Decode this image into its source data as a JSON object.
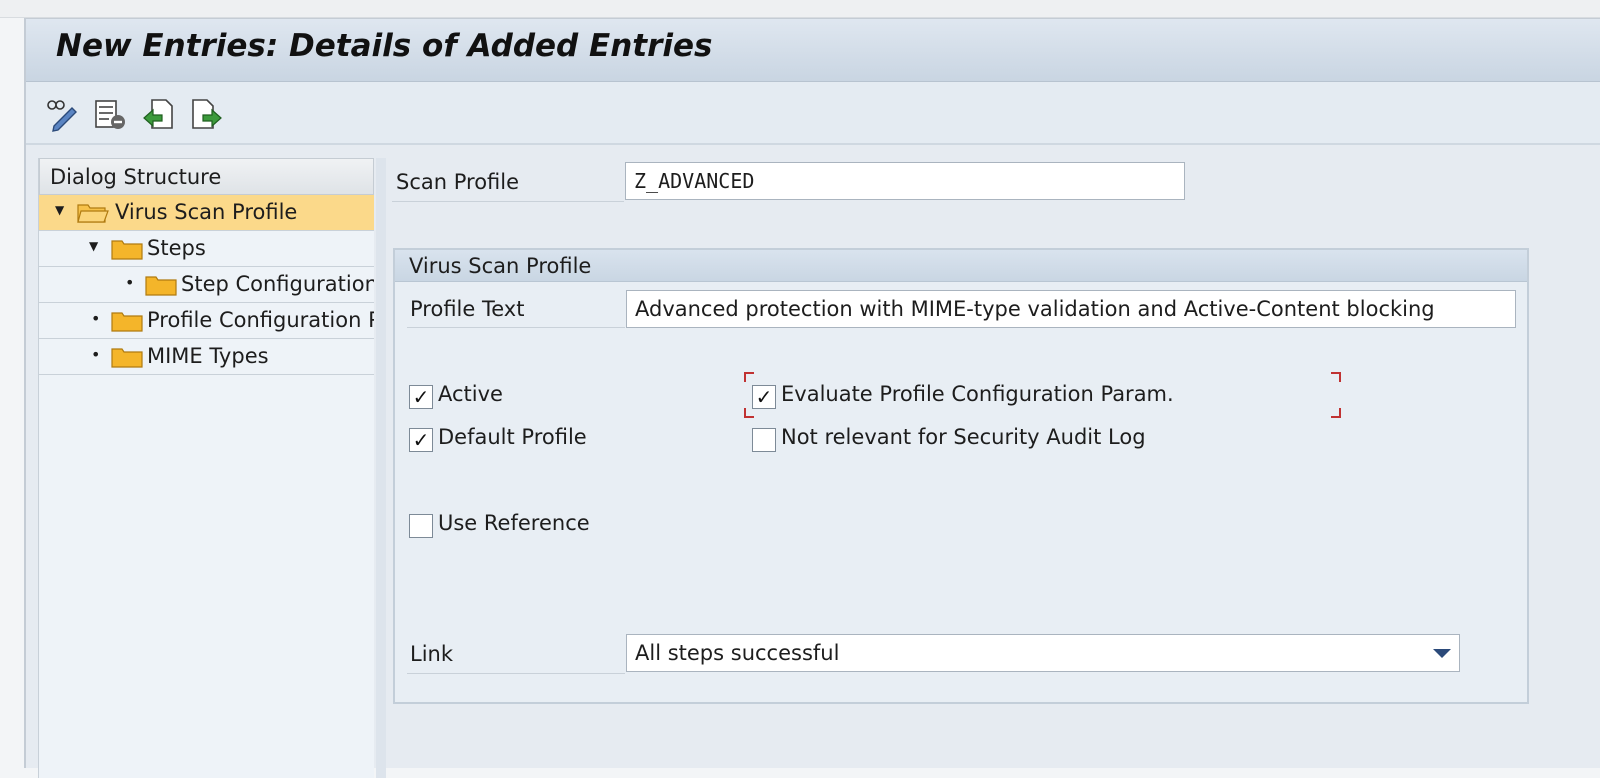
{
  "window": {
    "title": "New Entries: Details of Added Entries"
  },
  "toolbar": {
    "buttons": [
      {
        "icon": "display-change-icon"
      },
      {
        "icon": "delete-row-icon"
      },
      {
        "icon": "previous-entry-icon"
      },
      {
        "icon": "next-entry-icon"
      }
    ]
  },
  "dialog_structure": {
    "header": "Dialog Structure",
    "items": [
      {
        "label": "Virus Scan Profile",
        "level": 0,
        "expander": "▼",
        "selected": true
      },
      {
        "label": "Steps",
        "level": 1,
        "expander": "▼"
      },
      {
        "label": "Step Configuration",
        "level": 2,
        "expander": "•"
      },
      {
        "label": "Profile Configuration Parameters",
        "level": 1,
        "expander": "•"
      },
      {
        "label": "MIME Types",
        "level": 1,
        "expander": "•"
      }
    ]
  },
  "form": {
    "scan_profile_label": "Scan Profile",
    "scan_profile_value": "Z_ADVANCED",
    "group_title": "Virus Scan Profile",
    "profile_text_label": "Profile Text",
    "profile_text_value": "Advanced protection with MIME-type validation and Active-Content blocking",
    "checkboxes": {
      "active": {
        "label": "Active",
        "checked": true
      },
      "default_profile": {
        "label": "Default Profile",
        "checked": true
      },
      "use_reference": {
        "label": "Use Reference",
        "checked": false
      },
      "evaluate_param": {
        "label": "Evaluate Profile Configuration Param.",
        "checked": true
      },
      "not_relevant_audit": {
        "label": "Not relevant for Security Audit Log",
        "checked": false
      }
    },
    "link_label": "Link",
    "link_value": "All steps successful"
  },
  "colors": {
    "selected_row": "#fbd98a",
    "folder": "#f4b52a",
    "focus_corner": "#c03232"
  }
}
